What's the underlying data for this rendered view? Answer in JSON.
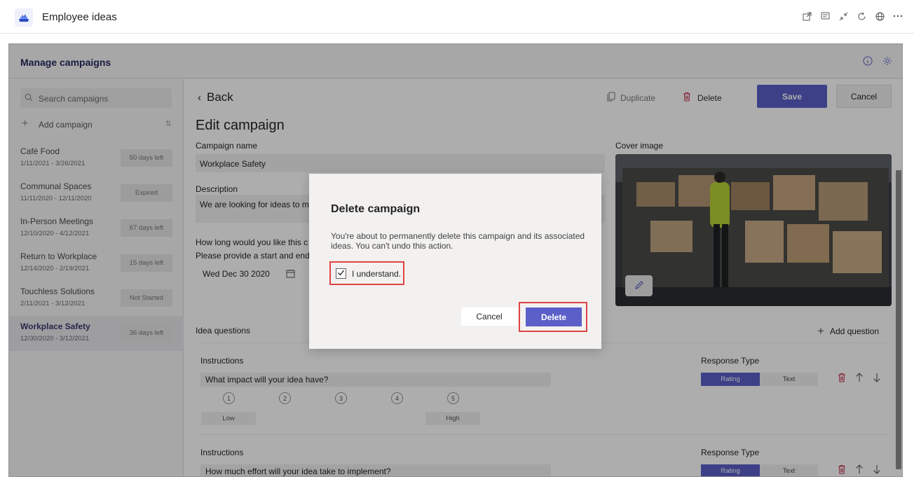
{
  "topbar": {
    "title": "Employee ideas",
    "icons": [
      "popout-icon",
      "chat-icon",
      "collapse-icon",
      "refresh-icon",
      "globe-icon",
      "more-icon"
    ]
  },
  "manage": {
    "title": "Manage campaigns",
    "icons": [
      "info-icon",
      "settings-icon"
    ]
  },
  "sidebar": {
    "search_placeholder": "Search campaigns",
    "add_campaign": "Add campaign",
    "campaigns": [
      {
        "name": "Café Food",
        "dates": "1/11/2021 - 3/26/2021",
        "status": "50 days left",
        "active": false
      },
      {
        "name": "Communal Spaces",
        "dates": "11/11/2020 - 12/11/2020",
        "status": "Expired",
        "active": false
      },
      {
        "name": "In-Person Meetings",
        "dates": "12/10/2020 - 4/12/2021",
        "status": "67 days left",
        "active": false
      },
      {
        "name": "Return to Workplace",
        "dates": "12/14/2020 - 2/19/2021",
        "status": "15 days left",
        "active": false
      },
      {
        "name": "Touchless Solutions",
        "dates": "2/11/2021 - 3/12/2021",
        "status": "Not Started",
        "active": false
      },
      {
        "name": "Workplace Safety",
        "dates": "12/30/2020 - 3/12/2021",
        "status": "36 days left",
        "active": true
      }
    ]
  },
  "editor": {
    "back": "Back",
    "duplicate": "Duplicate",
    "delete": "Delete",
    "save": "Save",
    "cancel": "Cancel",
    "heading": "Edit campaign",
    "campaign_name_label": "Campaign name",
    "campaign_name": "Workplace Safety",
    "description_label": "Description",
    "description": "We are looking for ideas to ma",
    "how_long_label": "How long would you like this c",
    "date_hint": "Please provide a start and end c",
    "start_date": "Wed Dec 30 2020",
    "cover_label": "Cover image",
    "idea_questions": "Idea questions",
    "add_question": "Add question",
    "questions": [
      {
        "instructions_label": "Instructions",
        "text": "What impact will your idea have?",
        "scale": [
          "1",
          "2",
          "3",
          "4",
          "5"
        ],
        "low": "Low",
        "high": "High",
        "response_type_label": "Response Type",
        "rating": "Rating",
        "text_option": "Text"
      },
      {
        "instructions_label": "Instructions",
        "text": "How much effort will your idea take to implement?",
        "response_type_label": "Response Type",
        "rating": "Rating",
        "text_option": "Text"
      }
    ]
  },
  "dialog": {
    "title": "Delete campaign",
    "body": "You're about to permanently delete this campaign and its associated ideas. You can't undo this action.",
    "checkbox_label": "I understand.",
    "checkbox_checked": true,
    "cancel": "Cancel",
    "delete": "Delete"
  },
  "colors": {
    "accent": "#5b5fc7",
    "danger": "#c4314b",
    "highlight": "#e04343",
    "title_navy": "#252861"
  }
}
